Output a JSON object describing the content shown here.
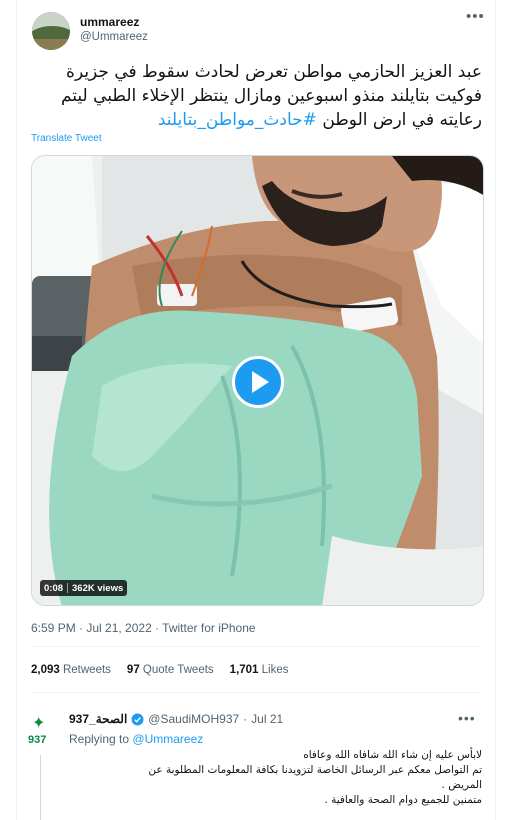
{
  "tweet": {
    "author_name": "ummareez",
    "author_handle": "@Ummareez",
    "more_icon": "•••",
    "text_line1": "عبد العزيز الحازمي مواطن تعرض لحادث سقوط في جزيرة",
    "text_line2": "فوكيت بتايلند منذو اسبوعين ومازال ينتظر الإخلاء الطبي ليتم",
    "text_line3": "رعايته في ارض الوطن",
    "hashtag": "#حادث_مواطن_بتايلند",
    "translate_label": "Translate Tweet",
    "video": {
      "duration": "0:08",
      "views": "362K views"
    },
    "meta": "6:59 PM · Jul 21, 2022 · Twitter for iPhone",
    "stats": {
      "retweets_count": "2,093",
      "retweets_label": "Retweets",
      "quotes_count": "97",
      "quotes_label": "Quote Tweets",
      "likes_count": "1,701",
      "likes_label": "Likes"
    }
  },
  "reply": {
    "logo_number": "937",
    "name": "937_الصحة",
    "handle": "@SaudiMOH937",
    "dot": "·",
    "date": "Jul 21",
    "more_icon": "•••",
    "replying_prefix": "Replying to",
    "replying_to": "@Ummareez",
    "line1": "لابأس عليه إن شاء الله شافاه الله وعافاه",
    "line2": "تم التواصل معكم عبر الرسائل الخاصة لتزويدنا بكافة المعلومات المطلوبة عن",
    "line3": "المريض .",
    "line4": "متمنين للجميع دوام الصحة والعافية ."
  },
  "colors": {
    "accent": "#1d9bf0",
    "text": "#0f1419",
    "secondary": "#536471",
    "gown": "#9ad8c2"
  }
}
